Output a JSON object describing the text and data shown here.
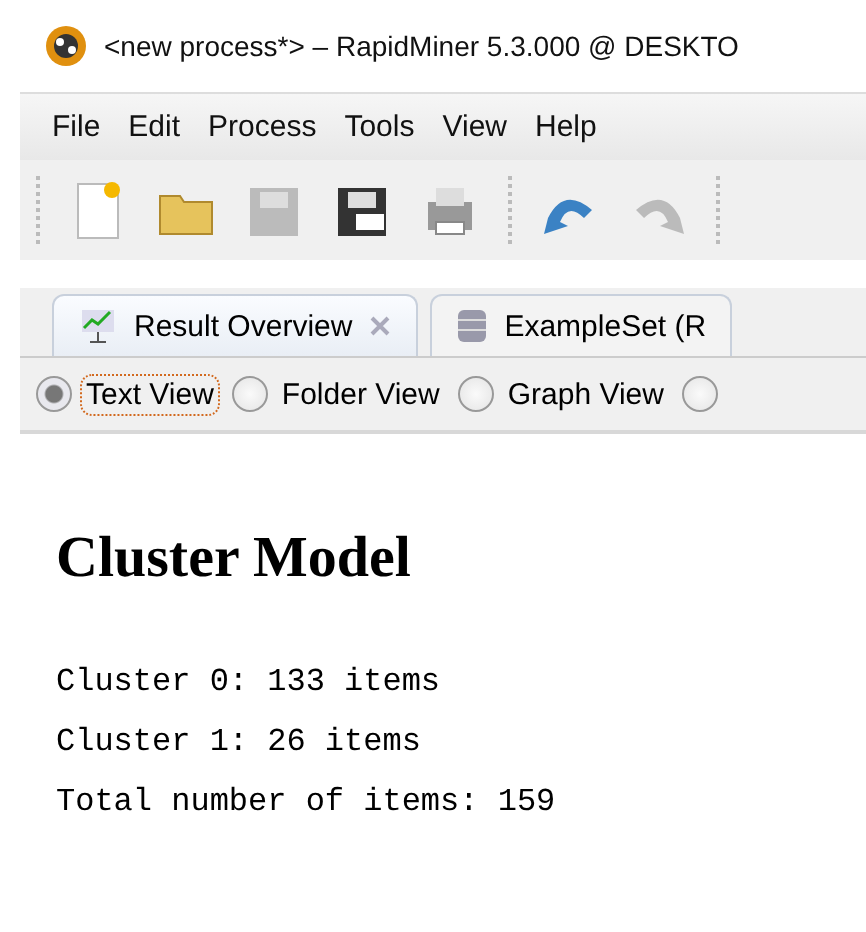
{
  "window": {
    "title": "<new process*> – RapidMiner 5.3.000 @ DESKTO"
  },
  "menu": [
    "File",
    "Edit",
    "Process",
    "Tools",
    "View",
    "Help"
  ],
  "tabs": [
    {
      "label": "Result Overview",
      "selected": true,
      "kind": "overview"
    },
    {
      "label": "ExampleSet (R",
      "selected": false,
      "kind": "data"
    }
  ],
  "views": [
    {
      "label": "Text View",
      "selected": true
    },
    {
      "label": "Folder View",
      "selected": false
    },
    {
      "label": "Graph View",
      "selected": false
    },
    {
      "selected": false
    }
  ],
  "content": {
    "heading": "Cluster Model",
    "lines": [
      "Cluster 0: 133 items",
      "Cluster 1: 26 items",
      "Total number of items: 159"
    ]
  }
}
